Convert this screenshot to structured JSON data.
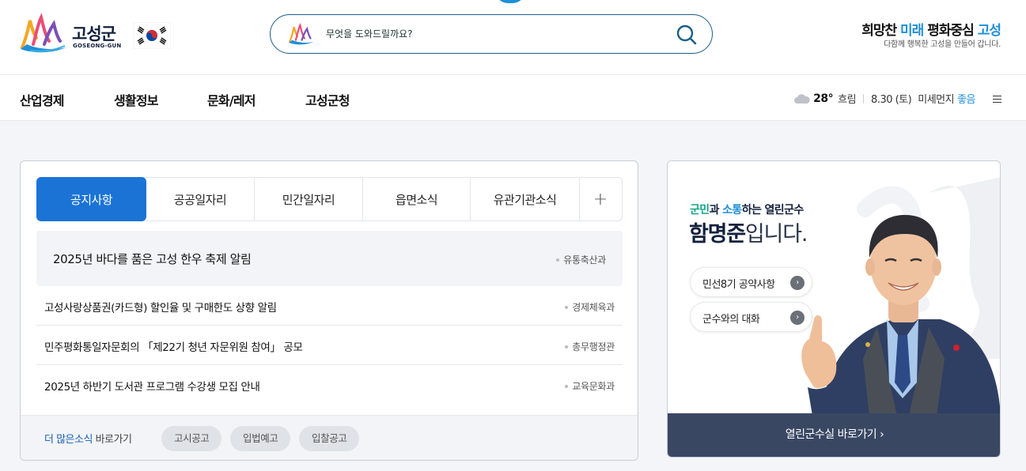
{
  "header": {
    "logo_text": "고성군",
    "logo_sub": "GOSEONG-GUN",
    "search_placeholder": "무엇을 도와드릴까요?",
    "slogan_part1": "희망찬 ",
    "slogan_part2": "미래",
    "slogan_part3": " 평화중심 ",
    "slogan_part4": "고성",
    "slogan_sub": "다함께 행복한 고성을 만들어 갑니다."
  },
  "nav": {
    "items": [
      "산업경제",
      "생활정보",
      "문화/레저",
      "고성군청"
    ]
  },
  "weather": {
    "temp": "28°",
    "condition": "흐림",
    "date": "8.30 (토)",
    "dust_label": "미세먼지",
    "dust_value": "좋음"
  },
  "notice": {
    "tabs": [
      "공지사항",
      "공공일자리",
      "민간일자리",
      "읍면소식",
      "유관기관소식"
    ],
    "plus": "+",
    "items": [
      {
        "title": "2025년 바다를 품은 고성 한우 축제 알림",
        "dept": "유통축산과"
      },
      {
        "title": "고성사랑상품권(카드형) 할인율 및 구매한도 상향 알림",
        "dept": "경제체육과"
      },
      {
        "title": "민주평화통일자문회의 「제22기 청년 자문위원 참여」 공모",
        "dept": "총무행정관"
      },
      {
        "title": "2025년 하반기 도서관 프로그램 수강생 모집 안내",
        "dept": "교육문화과"
      }
    ],
    "more_blue": "더 많은소식",
    "more_rest": " 바로가기",
    "pills": [
      "고시공고",
      "입법예고",
      "입찰공고"
    ]
  },
  "governor": {
    "line1_a": "군민",
    "line1_b": "과 ",
    "line1_c": "소통",
    "line1_d": "하는 ",
    "line1_e": "열린군수",
    "name": "함명준",
    "name_suffix": "입니다.",
    "btn1": "민선8기 공약사항",
    "btn2": "군수와의 대화",
    "footer": "열린군수실 바로가기 ›"
  },
  "colors": {
    "primary_blue": "#1b73d6",
    "accent": "#1f8fd6",
    "navy": "#14213d",
    "footer_navy": "#3a4763"
  }
}
